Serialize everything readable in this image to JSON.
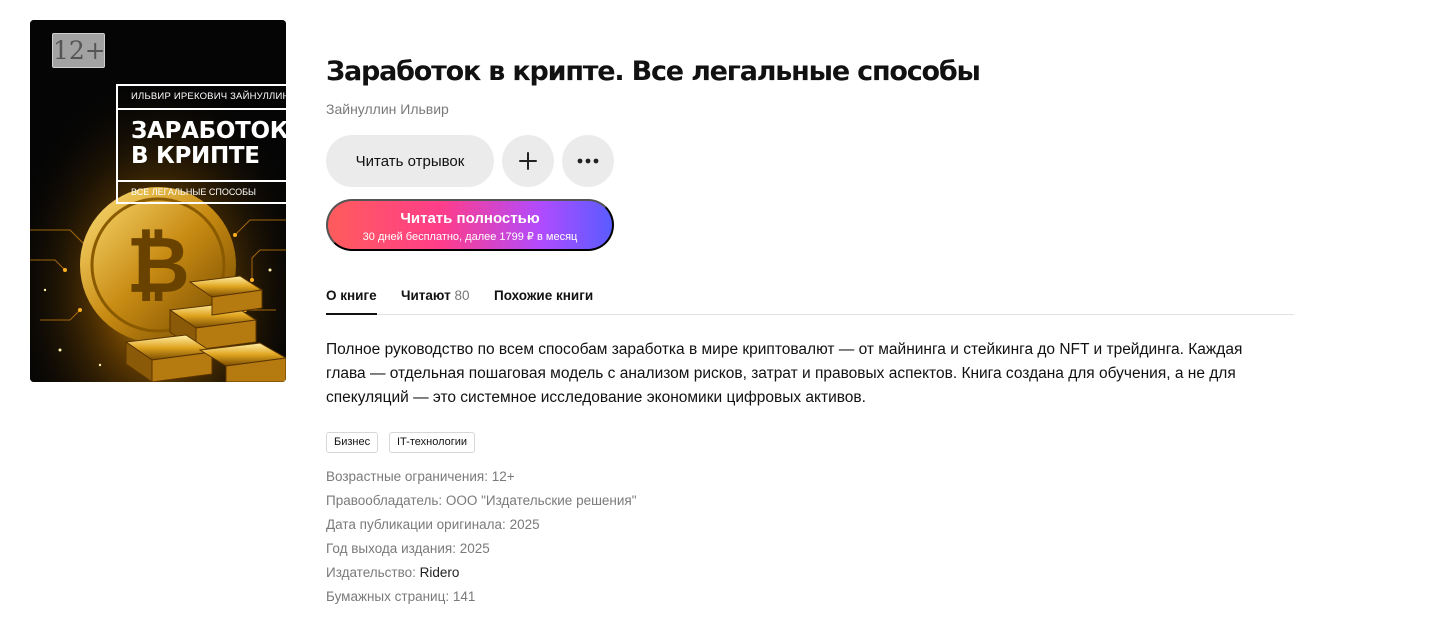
{
  "book": {
    "title": "Заработок в крипте. Все легальные способы",
    "author": "Зайнуллин Ильвир"
  },
  "cover": {
    "age_badge": "12+",
    "author": "ИЛЬВИР ИРЕКОВИЧ ЗАЙНУЛЛИН",
    "title_line1": "ЗАРАБОТОК",
    "title_line2": "В КРИПТЕ",
    "subtitle": "ВСЕ ЛЕГАЛЬНЫЕ СПОСОБЫ"
  },
  "actions": {
    "read_excerpt": "Читать отрывок",
    "add_icon": "plus-icon",
    "more_icon": "more-dots-icon",
    "read_full": "Читать полностью",
    "read_full_sub": "30 дней бесплатно, далее 1799 ₽ в месяц"
  },
  "tabs": [
    {
      "label": "О книге",
      "count": ""
    },
    {
      "label": "Читают",
      "count": "80"
    },
    {
      "label": "Похожие книги",
      "count": ""
    }
  ],
  "description": "Полное руководство по всем способам заработка в мире криптовалют — от майнинга и стейкинга до NFT и трейдинга. Каждая глава — отдельная пошаговая модель с анализом рисков, затрат и правовых аспектов. Книга создана для обучения, а не для спекуляций — это системное исследование экономики цифровых активов.",
  "tags": [
    "Бизнес",
    "IT-технологии"
  ],
  "meta": {
    "age_label": "Возрастные ограничения:",
    "age_value": "12+",
    "rights_label": "Правообладатель:",
    "rights_value": "ООО \"Издательские решения\"",
    "orig_date_label": "Дата публикации оригинала:",
    "orig_date_value": "2025",
    "year_label": "Год выхода издания:",
    "year_value": "2025",
    "publisher_label": "Издательство:",
    "publisher_value": "Ridero",
    "pages_label": "Бумажных страниц:",
    "pages_value": "141"
  },
  "colors": {
    "gradient_start": "#ff5c5c",
    "gradient_end": "#5a5cff",
    "button_grey": "#ebebeb",
    "muted_text": "#7a7a7a"
  }
}
